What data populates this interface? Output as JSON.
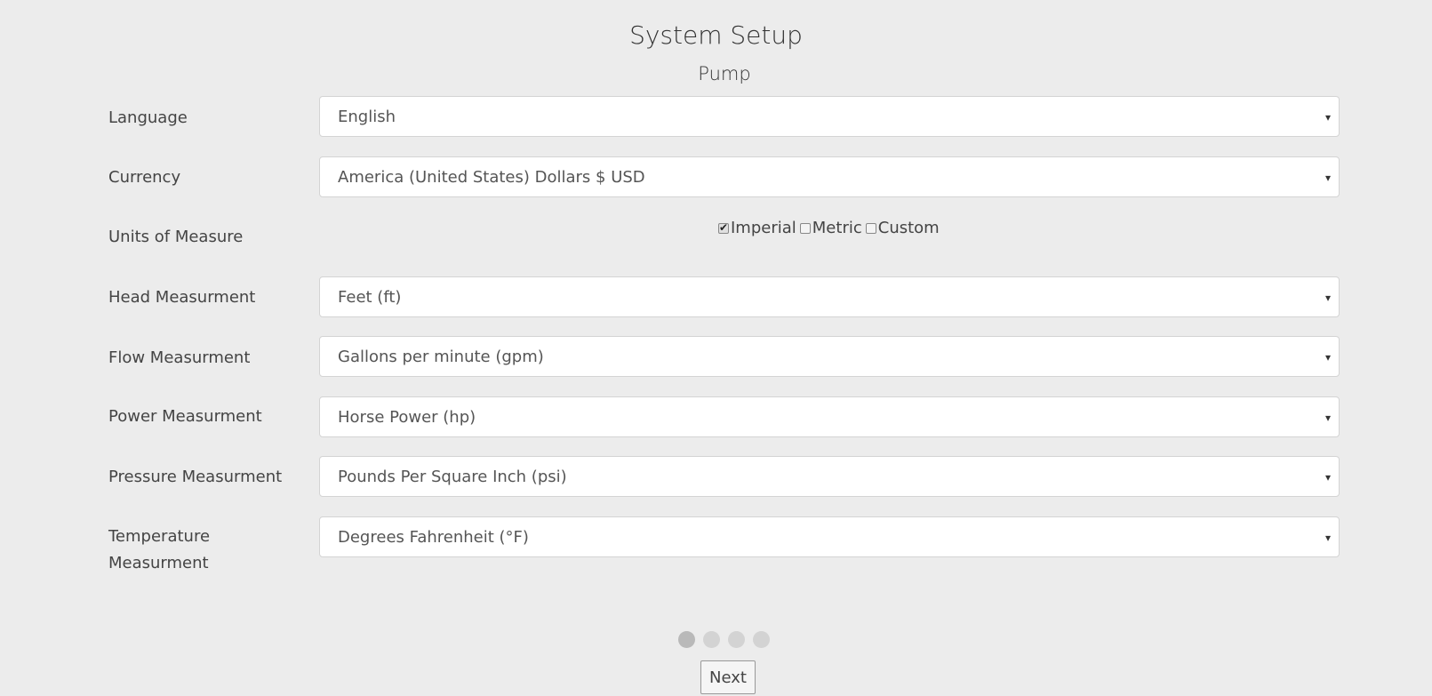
{
  "header": {
    "title": "System Setup",
    "subtitle": "Pump"
  },
  "fields": {
    "language": {
      "label": "Language",
      "value": "English"
    },
    "currency": {
      "label": "Currency",
      "value": "America (United States) Dollars $ USD"
    },
    "units": {
      "label": "Units of Measure",
      "options": [
        {
          "label": "Imperial",
          "checked": true
        },
        {
          "label": "Metric",
          "checked": false
        },
        {
          "label": "Custom",
          "checked": false
        }
      ]
    },
    "head": {
      "label": "Head Measurment",
      "value": "Feet (ft)"
    },
    "flow": {
      "label": "Flow Measurment",
      "value": "Gallons per minute (gpm)"
    },
    "power": {
      "label": "Power Measurment",
      "value": "Horse Power (hp)"
    },
    "pressure": {
      "label": "Pressure Measurment",
      "value": "Pounds Per Square Inch (psi)"
    },
    "temperature": {
      "label_line1": "Temperature",
      "label_line2": "Measurment",
      "value": "Degrees Fahrenheit (°F)"
    }
  },
  "caret_glyph": "▾",
  "check_glyph": "✔",
  "pagination": {
    "total_steps": 4,
    "current_step": 1
  },
  "actions": {
    "next_label": "Next"
  }
}
